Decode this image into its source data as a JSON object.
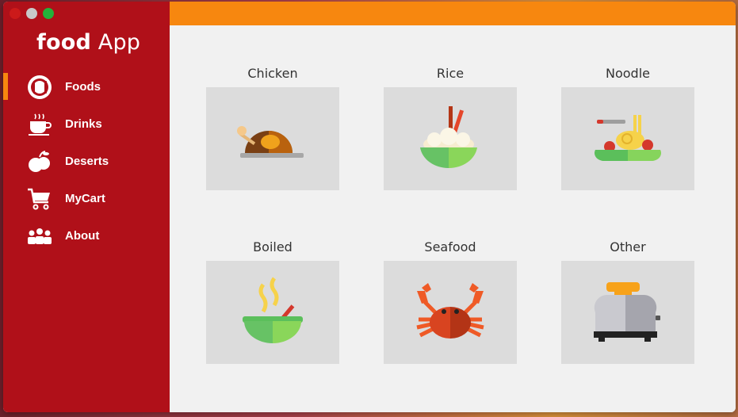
{
  "window": {
    "controls": [
      "close",
      "minimize",
      "maximize"
    ]
  },
  "brand": {
    "bold": "food",
    "regular": "App"
  },
  "nav": [
    {
      "label": "Foods",
      "icon": "food-plate-icon",
      "active": true
    },
    {
      "label": "Drinks",
      "icon": "coffee-cup-icon",
      "active": false
    },
    {
      "label": "Deserts",
      "icon": "fruit-icon",
      "active": false
    },
    {
      "label": "MyCart",
      "icon": "cart-icon",
      "active": false
    },
    {
      "label": "About",
      "icon": "people-icon",
      "active": false
    }
  ],
  "categories": [
    {
      "label": "Chicken",
      "icon": "roast-chicken-icon"
    },
    {
      "label": "Rice",
      "icon": "rice-bowl-icon"
    },
    {
      "label": "Noodle",
      "icon": "noodle-plate-icon"
    },
    {
      "label": "Boiled",
      "icon": "soup-bowl-icon"
    },
    {
      "label": "Seafood",
      "icon": "crab-icon"
    },
    {
      "label": "Other",
      "icon": "toaster-icon"
    }
  ],
  "colors": {
    "sidebar": "#b01019",
    "accent": "#f7870f",
    "content_bg": "#f1f1f1",
    "tile_bg": "#dcdcdc"
  }
}
